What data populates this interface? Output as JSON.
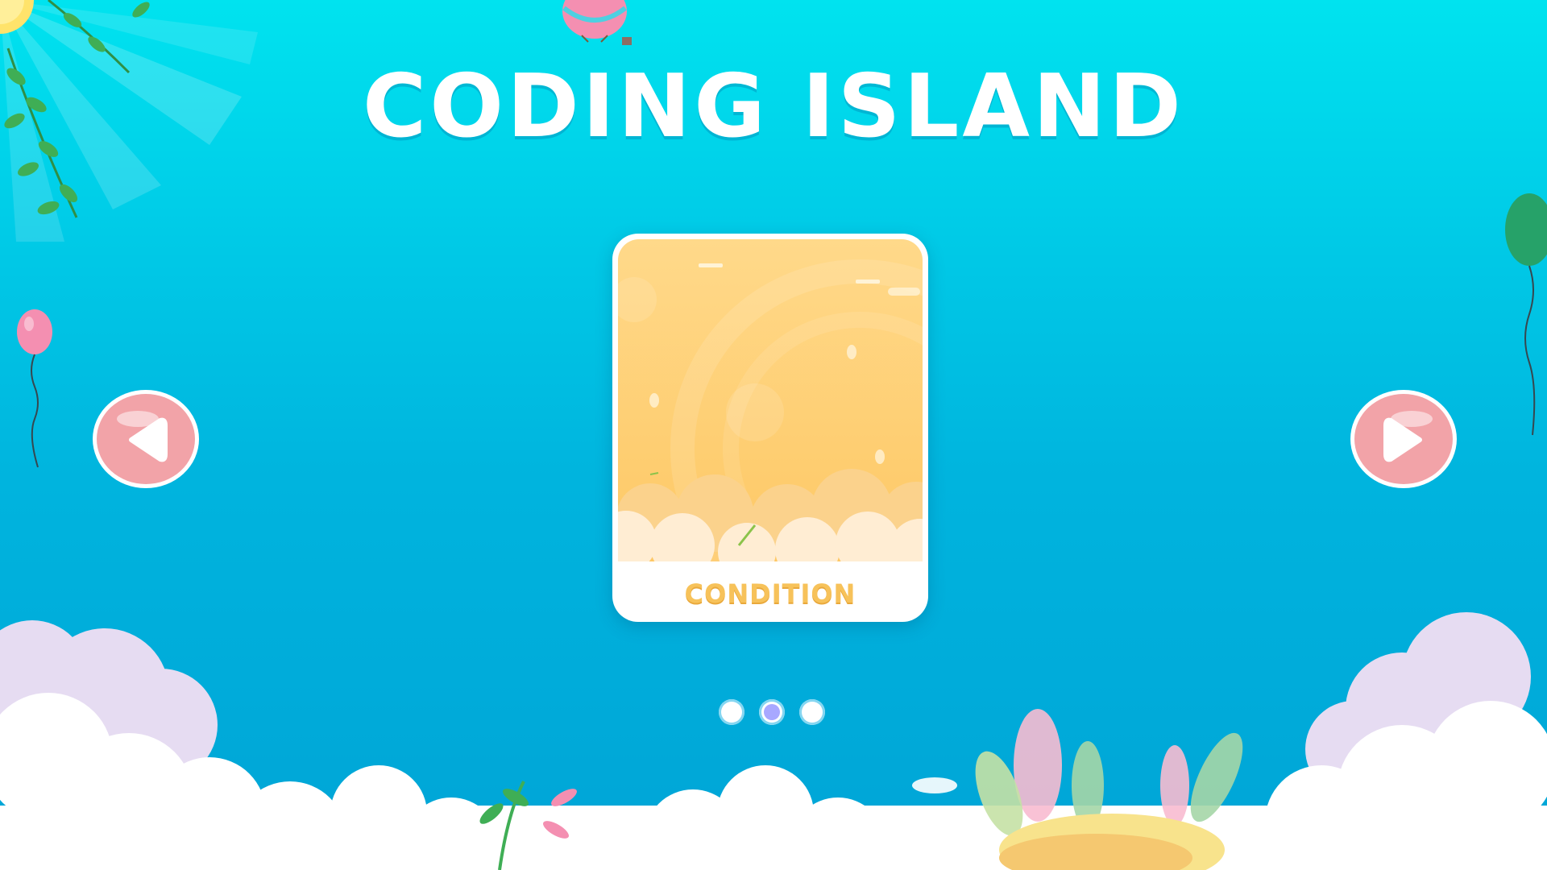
{
  "app": {
    "title": "CODING ISLAND"
  },
  "carousel": {
    "current_card": {
      "label": "CONDITION",
      "index": 2,
      "total": 3
    },
    "prev_button_icon": "triangle-left-icon",
    "next_button_icon": "triangle-right-icon",
    "dots": [
      {
        "active": false
      },
      {
        "active": true
      },
      {
        "active": false
      }
    ]
  },
  "colors": {
    "sky_top": "#00E3EF",
    "sky_bottom": "#00A4D6",
    "card_label": "#F7C25A",
    "nav_button": "#F2A3A8",
    "dot_active": "#A8A8FF",
    "dot_inactive": "#FFFFFF"
  }
}
